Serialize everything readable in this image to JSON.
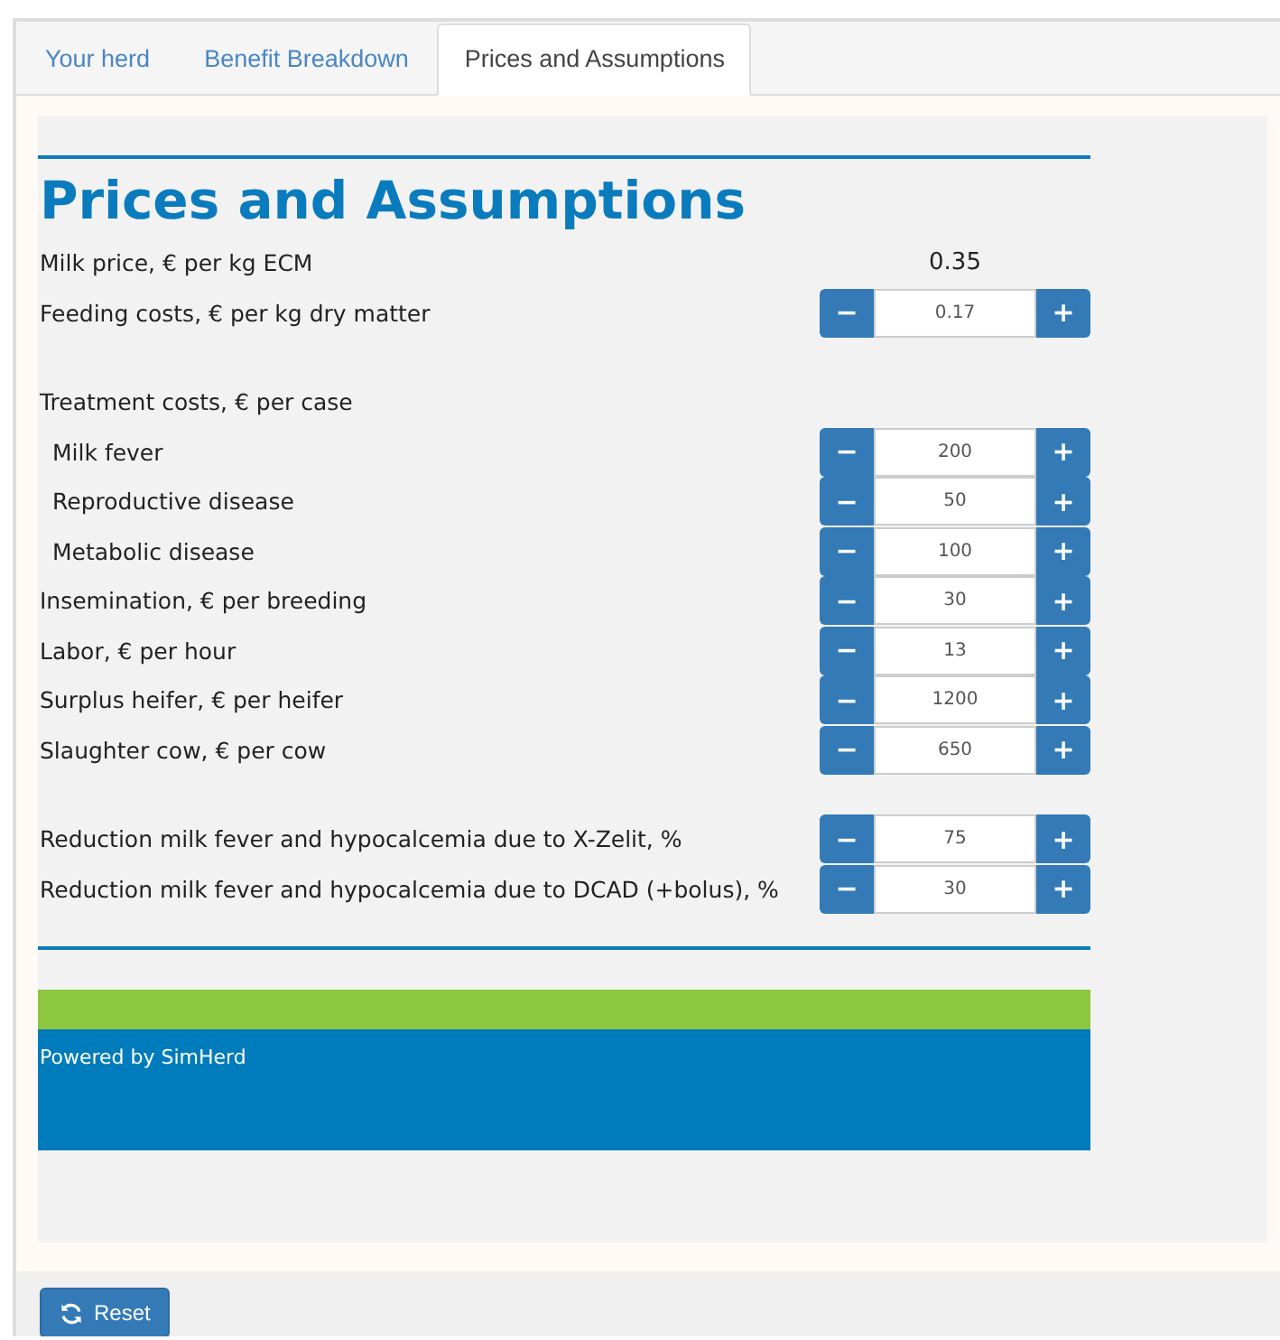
{
  "tabs": [
    {
      "label": "Your herd",
      "selected": false
    },
    {
      "label": "Benefit Breakdown",
      "selected": false
    },
    {
      "label": "Prices and Assumptions",
      "selected": true
    }
  ],
  "title": "Prices and Assumptions",
  "sections": [
    {
      "rows": [
        {
          "kind": "value",
          "label": "Milk price, € per kg ECM",
          "value": "0.35"
        },
        {
          "kind": "stepper",
          "label": "Feeding costs, € per kg dry matter",
          "value": "0.17",
          "minus": "−",
          "plus": "+"
        }
      ]
    },
    {
      "rows": [
        {
          "kind": "header",
          "label": "Treatment costs, € per case",
          "children": [
            {
              "kind": "stepper",
              "label": "Milk fever",
              "value": "200",
              "minus": "−",
              "plus": "+"
            },
            {
              "kind": "stepper",
              "label": "Reproductive disease",
              "value": "50",
              "minus": "−",
              "plus": "+"
            },
            {
              "kind": "stepper",
              "label": "Metabolic disease",
              "value": "100",
              "minus": "−",
              "plus": "+"
            }
          ]
        },
        {
          "kind": "stepper",
          "label": "Insemination, € per breeding",
          "value": "30",
          "minus": "−",
          "plus": "+"
        },
        {
          "kind": "stepper",
          "label": "Labor, € per hour",
          "value": "13",
          "minus": "−",
          "plus": "+"
        },
        {
          "kind": "stepper",
          "label": "Surplus heifer, € per heifer",
          "value": "1200",
          "minus": "−",
          "plus": "+"
        },
        {
          "kind": "stepper",
          "label": "Slaughter cow, € per cow",
          "value": "650",
          "minus": "−",
          "plus": "+"
        }
      ]
    },
    {
      "rows": [
        {
          "kind": "stepper",
          "label": "Reduction milk fever and hypocalcemia due to X-Zelit, %",
          "value": "75",
          "minus": "−",
          "plus": "+"
        },
        {
          "kind": "stepper",
          "label": "Reduction milk fever and hypocalcemia due to DCAD (+bolus), %",
          "value": "30",
          "minus": "−",
          "plus": "+"
        }
      ]
    }
  ],
  "footer": "Powered by SimHerd",
  "reset_button": "Reset"
}
